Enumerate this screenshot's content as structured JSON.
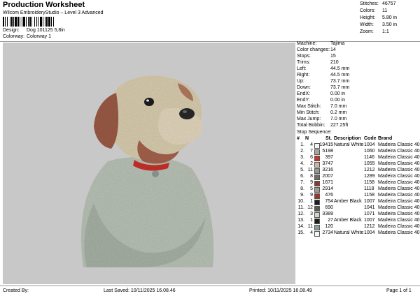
{
  "header": {
    "title": "Production Worksheet",
    "subtitle": "Wilcom EmbroideryStudio – Level 3 Advanced",
    "barcode_text": "││││││",
    "design_label": "Design:",
    "design_value": "Dog 101125 5,8in",
    "colorway_label": "Colorway:",
    "colorway_value": "Colorway 1"
  },
  "stats": [
    {
      "label": "Stitches:",
      "value": "46757"
    },
    {
      "label": "Colors:",
      "value": "11"
    },
    {
      "label": "Height:",
      "value": "5.80 in"
    },
    {
      "label": "Width:",
      "value": "3.50 in"
    },
    {
      "label": "Zoom:",
      "value": "1:1"
    }
  ],
  "machine_info": [
    {
      "label": "Machine:",
      "value": "Tajima"
    },
    {
      "label": "Color changes:",
      "value": "14"
    },
    {
      "label": "Stops:",
      "value": "15"
    },
    {
      "label": "Trims:",
      "value": "210"
    },
    {
      "label": "Left:",
      "value": "44.5 mm"
    },
    {
      "label": "Right:",
      "value": "44.5 mm"
    },
    {
      "label": "Up:",
      "value": "73.7 mm"
    },
    {
      "label": "Down:",
      "value": "73.7 mm"
    },
    {
      "label": "EndX:",
      "value": "0.00 in"
    },
    {
      "label": "EndY:",
      "value": "0.00 in"
    },
    {
      "label": "Max Stitch:",
      "value": "7.0 mm"
    },
    {
      "label": "Min Stitch:",
      "value": "0.2 mm"
    },
    {
      "label": "Max Jump:",
      "value": "7.0 mm"
    },
    {
      "label": "Total Bobbin:",
      "value": "227.25ft"
    }
  ],
  "stop_sequence": {
    "title": "Stop Sequence:",
    "headers": {
      "num": "#",
      "n": "N",
      "st": "St.",
      "desc": "Description",
      "code": "Code",
      "brand": "Brand"
    },
    "rows": [
      {
        "num": "1.",
        "n": "4",
        "color": "#f4f4f0",
        "st": "19415",
        "desc": "Natural White",
        "code": "1004",
        "brand": "Madeira Classic 40"
      },
      {
        "num": "2.",
        "n": "7",
        "color": "#a8a59a",
        "st": "5198",
        "desc": "",
        "code": "1060",
        "brand": "Madeira Classic 40"
      },
      {
        "num": "3.",
        "n": "6",
        "color": "#c8302a",
        "st": "397",
        "desc": "",
        "code": "1146",
        "brand": "Madeira Classic 40"
      },
      {
        "num": "4.",
        "n": "2",
        "color": "#cbb59a",
        "st": "3747",
        "desc": "",
        "code": "1055",
        "brand": "Madeira Classic 40"
      },
      {
        "num": "5.",
        "n": "11",
        "color": "#8e9a94",
        "st": "3216",
        "desc": "",
        "code": "1212",
        "brand": "Madeira Classic 40"
      },
      {
        "num": "6.",
        "n": "8",
        "color": "#6e6a64",
        "st": "2007",
        "desc": "",
        "code": "1289",
        "brand": "Madeira Classic 40"
      },
      {
        "num": "7.",
        "n": "9",
        "color": "#8a3a2c",
        "st": "1671",
        "desc": "",
        "code": "1158",
        "brand": "Madeira Classic 40"
      },
      {
        "num": "8.",
        "n": "5",
        "color": "#9a9a8c",
        "st": "2914",
        "desc": "",
        "code": "1118",
        "brand": "Madeira Classic 40"
      },
      {
        "num": "9.",
        "n": "9",
        "color": "#a83024",
        "st": "476",
        "desc": "",
        "code": "1158",
        "brand": "Madeira Classic 40"
      },
      {
        "num": "10.",
        "n": "1",
        "color": "#1c1c1c",
        "st": "754",
        "desc": "Amber Black",
        "code": "1007",
        "brand": "Madeira Classic 40"
      },
      {
        "num": "11.",
        "n": "12",
        "color": "#5a5854",
        "st": "690",
        "desc": "",
        "code": "1041",
        "brand": "Madeira Classic 40"
      },
      {
        "num": "12.",
        "n": "3",
        "color": "#d8d4c8",
        "st": "3389",
        "desc": "",
        "code": "1071",
        "brand": "Madeira Classic 40"
      },
      {
        "num": "13.",
        "n": "1",
        "color": "#1c1c1c",
        "st": "27",
        "desc": "Amber Black",
        "code": "1007",
        "brand": "Madeira Classic 40"
      },
      {
        "num": "14.",
        "n": "11",
        "color": "#8e9a94",
        "st": "120",
        "desc": "",
        "code": "1212",
        "brand": "Madeira Classic 40"
      },
      {
        "num": "15.",
        "n": "4",
        "color": "#f4f4f0",
        "st": "2734",
        "desc": "Natural White",
        "code": "1004",
        "brand": "Madeira Classic 40"
      }
    ]
  },
  "footer": {
    "created_by": "Created By:",
    "last_saved": "Last Saved: 10/11/2025 16.08.46",
    "printed": "Printed: 10/11/2025 16.08.49",
    "page": "Page 1 of 1"
  },
  "colors": {
    "design_background": "#c8c8c8",
    "rule": "#999999"
  }
}
